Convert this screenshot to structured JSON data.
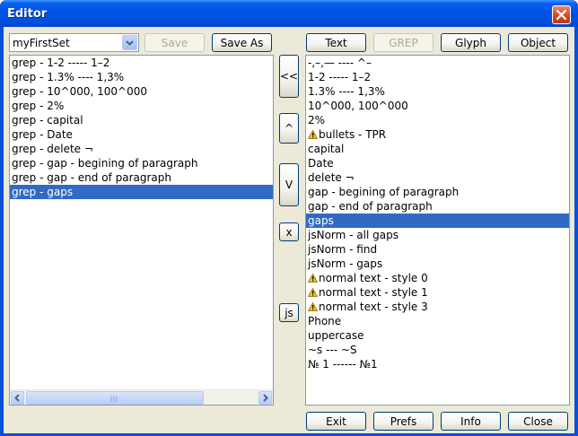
{
  "window": {
    "title": "Editor"
  },
  "toolbar_left": {
    "set_select": {
      "value": "myFirstSet"
    },
    "save_label": "Save",
    "save_as_label": "Save As"
  },
  "toolbar_right": {
    "text_label": "Text",
    "grep_label": "GREP",
    "glyph_label": "Glyph",
    "object_label": "Object"
  },
  "left_list": {
    "items": [
      "grep - 1-2 ----- 1–2",
      "grep - 1.3% ---- 1,3%",
      "grep - 10^000, 100^000",
      "grep - 2%",
      "grep - capital",
      "grep - Date",
      "grep - delete ¬",
      "grep - gap - begining of paragraph",
      "grep - gap - end of paragraph",
      "grep - gaps"
    ],
    "selected_index": 9
  },
  "middle_buttons": {
    "move_left_label": "<<",
    "up_label": "^",
    "down_label": "V",
    "delete_label": "x",
    "js_label": "js"
  },
  "right_list": {
    "items": [
      {
        "text": "-,–,— ---- ^–",
        "warn": false
      },
      {
        "text": "1-2 ----- 1–2",
        "warn": false
      },
      {
        "text": "1.3% ---- 1,3%",
        "warn": false
      },
      {
        "text": "10^000, 100^000",
        "warn": false
      },
      {
        "text": "2%",
        "warn": false
      },
      {
        "text": "bullets - TPR",
        "warn": true
      },
      {
        "text": "capital",
        "warn": false
      },
      {
        "text": "Date",
        "warn": false
      },
      {
        "text": "delete ¬",
        "warn": false
      },
      {
        "text": "gap - begining of paragraph",
        "warn": false
      },
      {
        "text": "gap - end of paragraph",
        "warn": false
      },
      {
        "text": "gaps",
        "warn": false
      },
      {
        "text": "jsNorm - all gaps",
        "warn": false
      },
      {
        "text": "jsNorm - find",
        "warn": false
      },
      {
        "text": "jsNorm - gaps",
        "warn": false
      },
      {
        "text": "normal text - style 0",
        "warn": true
      },
      {
        "text": "normal text - style 1",
        "warn": true
      },
      {
        "text": "normal text - style 3",
        "warn": true
      },
      {
        "text": "Phone",
        "warn": false
      },
      {
        "text": "uppercase",
        "warn": false
      },
      {
        "text": "~s --- ~S",
        "warn": false
      },
      {
        "text": "№ 1 ------ №1",
        "warn": false
      }
    ],
    "selected_index": 11
  },
  "bottom_buttons": {
    "exit_label": "Exit",
    "prefs_label": "Prefs",
    "info_label": "Info",
    "close_label": "Close"
  },
  "colors": {
    "titlebar": "#0053E5",
    "selection": "#316AC5",
    "window_bg": "#ECE9D8",
    "close_button": "#D2431A",
    "warning": "#F2C21E"
  }
}
